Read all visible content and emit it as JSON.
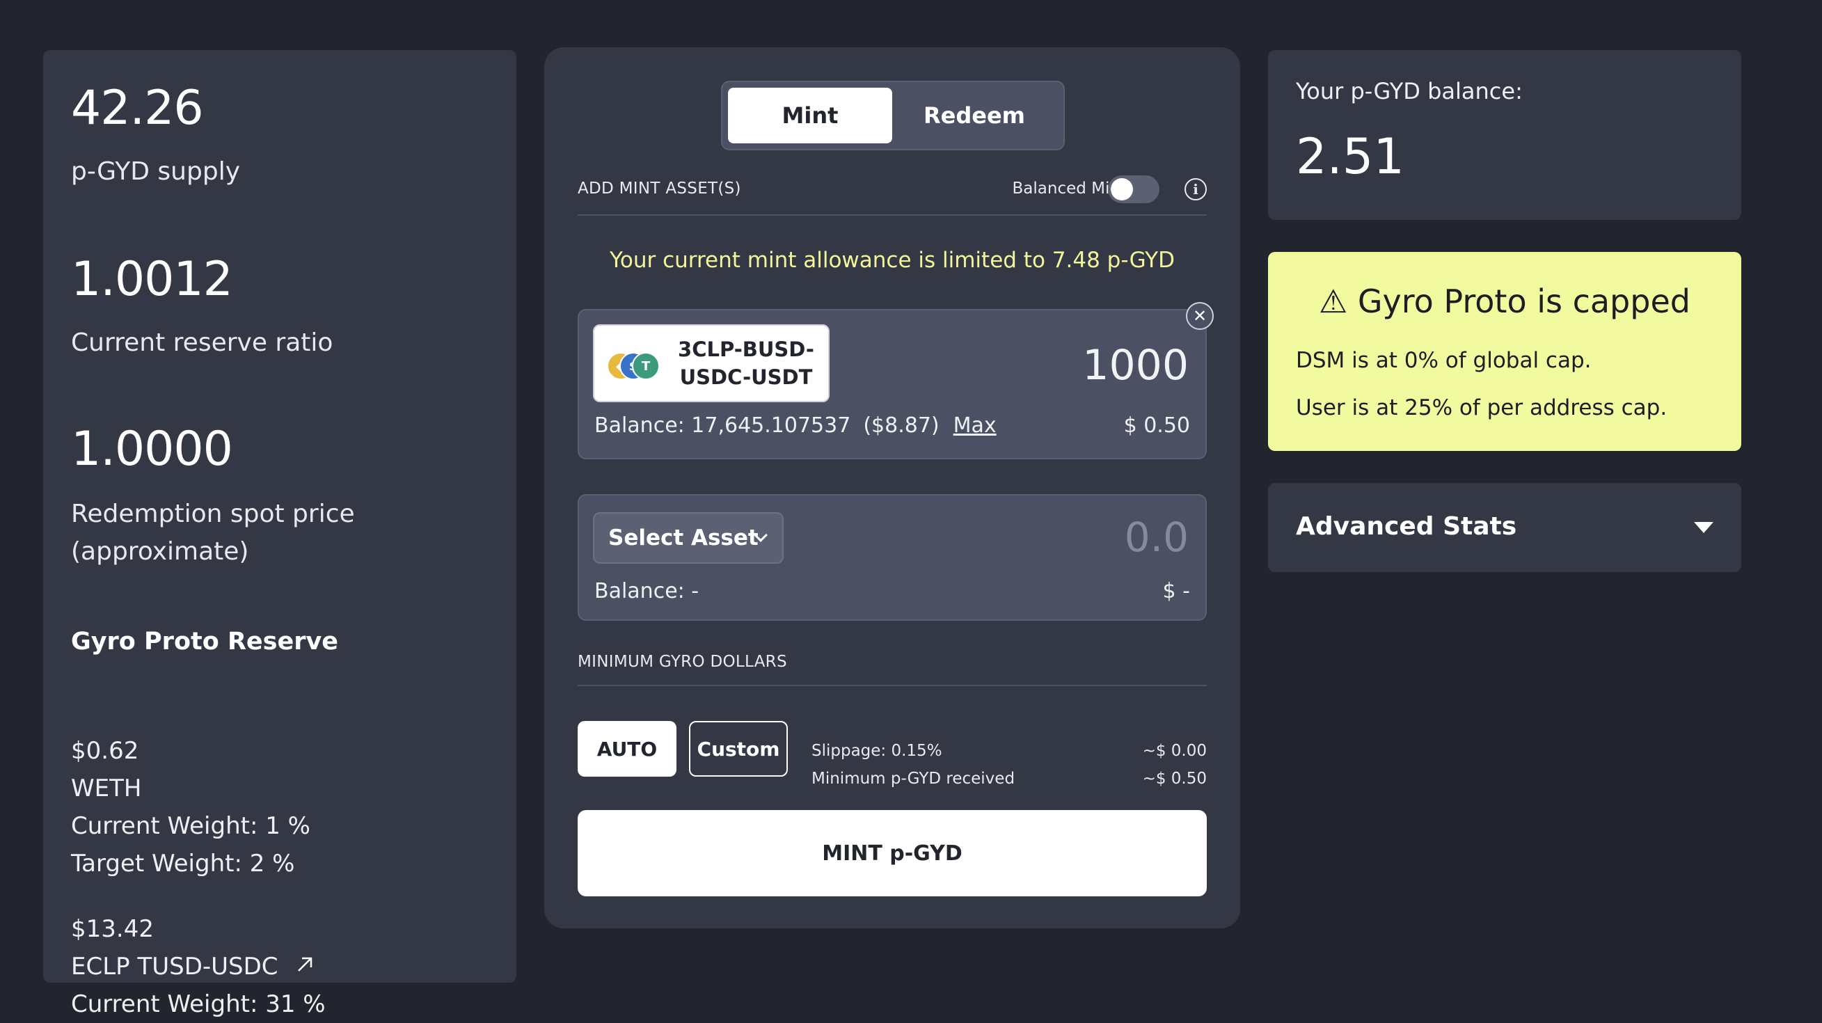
{
  "left_panel": {
    "stats": [
      {
        "value": "42.26",
        "label": "p-GYD supply"
      },
      {
        "value": "1.0012",
        "label": "Current reserve ratio"
      },
      {
        "value": "1.0000",
        "label": "Redemption spot price",
        "label2": "(approximate)"
      }
    ],
    "reserve_title": "Gyro Proto Reserve",
    "reserve_assets": [
      {
        "amount": "$0.62",
        "name": "WETH",
        "current_weight": "Current Weight: 1 %",
        "target_weight": "Target Weight: 2 %"
      },
      {
        "amount": "$13.42",
        "name": "ECLP TUSD-USDC",
        "link_icon": "external-link-icon",
        "current_weight": "Current Weight: 31 %"
      }
    ]
  },
  "mint_panel": {
    "tabs": [
      {
        "label": "Mint",
        "active": true
      },
      {
        "label": "Redeem",
        "active": false
      }
    ],
    "add_asset_header": "ADD MINT ASSET(S)",
    "balanced_mint_label": "Balanced Mint",
    "balanced_mint_on": false,
    "info_icon": "i",
    "allowance_text": "Your current mint allowance is limited to 7.48 p-GYD",
    "asset_1": {
      "token_name": "3CLP-BUSD-USDC-USDT",
      "token_name_line1": "3CLP-BUSD-",
      "token_name_line2": "USDC-USDT",
      "amount": "1000",
      "balance_label": "Balance: 17,645.107537",
      "balance_usd": "($8.87)",
      "max_label": "Max",
      "usd_value": "$ 0.50",
      "close_glyph": "✕"
    },
    "asset_2": {
      "select_label": "Select Asset",
      "amount_placeholder": "0.0",
      "balance_label": "Balance: -",
      "usd_value": "$ -"
    },
    "min_header": "MINIMUM GYRO DOLLARS",
    "auto_label": "AUTO",
    "custom_label": "Custom",
    "slippage_label": "Slippage: 0.15%",
    "slippage_value": "~$ 0.00",
    "min_received_label": "Minimum p-GYD received",
    "min_received_value": "~$ 0.50",
    "mint_button": "MINT p-GYD"
  },
  "right_panel": {
    "balance_label": "Your p-GYD balance:",
    "balance_value": "2.51",
    "capped_title": "⚠ Gyro Proto is capped",
    "capped_lines": [
      "DSM is at 0% of global cap.",
      "User is at 25% of per address cap."
    ],
    "advanced_title": "Advanced Stats"
  },
  "colors": {
    "background": "#22252e",
    "panel": "#343844",
    "input": "#4b5163",
    "warning_bg": "#f1fa9f",
    "allowance_text": "#f3f59a"
  }
}
